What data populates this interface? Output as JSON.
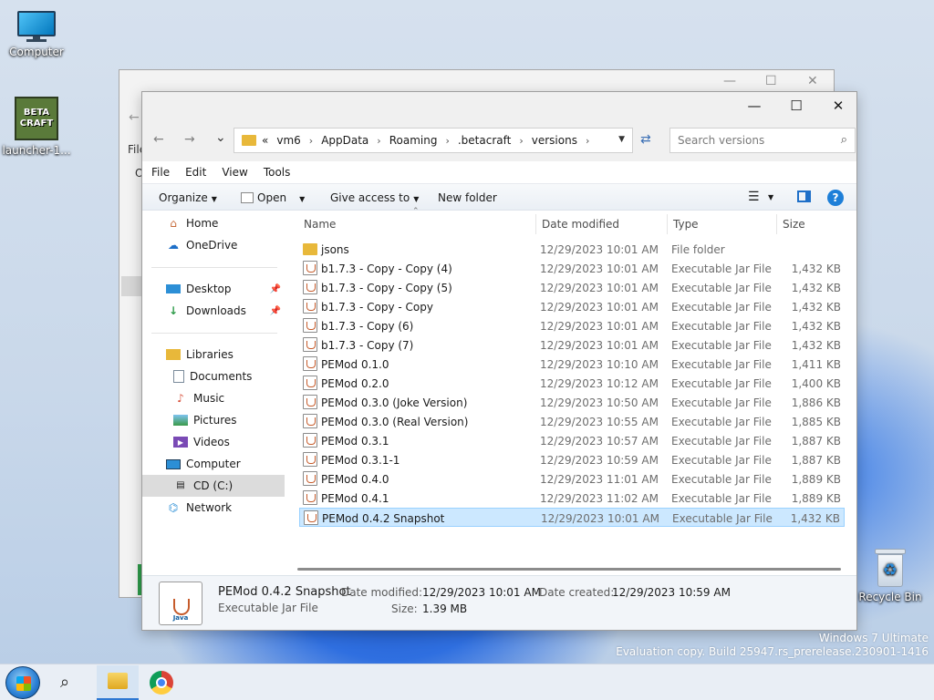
{
  "desktop": {
    "icons": [
      {
        "label": "Computer"
      },
      {
        "label": "launcher-1...",
        "logo_text": "BETA CRAFT"
      },
      {
        "label": "Recycle Bin"
      }
    ],
    "watermark": {
      "line1": "Windows 7 Ultimate",
      "line2": "Evaluation copy. Build 25947.rs_prerelease.230901-1416"
    }
  },
  "background_window": {
    "partial_text_1": "File",
    "partial_text_2": "O"
  },
  "window": {
    "controls": {
      "minimize": "—",
      "maximize": "☐",
      "close": "✕"
    },
    "nav": {
      "back": "←",
      "forward": "→",
      "recent": "⌄"
    },
    "address": {
      "overflow": "«",
      "crumbs": [
        "vm6",
        "AppData",
        "Roaming",
        ".betacraft",
        "versions"
      ],
      "separator": "›"
    },
    "search": {
      "placeholder": "Search versions"
    },
    "menu": [
      "File",
      "Edit",
      "View",
      "Tools"
    ],
    "toolbar": {
      "organize": "Organize",
      "open": "Open",
      "give_access": "Give access to",
      "new_folder": "New folder"
    },
    "nav_pane": {
      "home": "Home",
      "onedrive": "OneDrive",
      "desktop": "Desktop",
      "downloads": "Downloads",
      "libraries": "Libraries",
      "documents": "Documents",
      "music": "Music",
      "pictures": "Pictures",
      "videos": "Videos",
      "computer": "Computer",
      "cd": "CD (C:)",
      "network": "Network"
    },
    "columns": {
      "name": "Name",
      "date": "Date modified",
      "type": "Type",
      "size": "Size"
    },
    "files": [
      {
        "name": "jsons",
        "date": "12/29/2023 10:01 AM",
        "type": "File folder",
        "size": "",
        "kind": "folder"
      },
      {
        "name": "b1.7.3 - Copy - Copy (4)",
        "date": "12/29/2023 10:01 AM",
        "type": "Executable Jar File",
        "size": "1,432 KB",
        "kind": "jar"
      },
      {
        "name": "b1.7.3 - Copy - Copy (5)",
        "date": "12/29/2023 10:01 AM",
        "type": "Executable Jar File",
        "size": "1,432 KB",
        "kind": "jar"
      },
      {
        "name": "b1.7.3 - Copy - Copy",
        "date": "12/29/2023 10:01 AM",
        "type": "Executable Jar File",
        "size": "1,432 KB",
        "kind": "jar"
      },
      {
        "name": "b1.7.3 - Copy (6)",
        "date": "12/29/2023 10:01 AM",
        "type": "Executable Jar File",
        "size": "1,432 KB",
        "kind": "jar"
      },
      {
        "name": "b1.7.3 - Copy (7)",
        "date": "12/29/2023 10:01 AM",
        "type": "Executable Jar File",
        "size": "1,432 KB",
        "kind": "jar"
      },
      {
        "name": "PEMod 0.1.0",
        "date": "12/29/2023 10:10 AM",
        "type": "Executable Jar File",
        "size": "1,411 KB",
        "kind": "jar"
      },
      {
        "name": "PEMod 0.2.0",
        "date": "12/29/2023 10:12 AM",
        "type": "Executable Jar File",
        "size": "1,400 KB",
        "kind": "jar"
      },
      {
        "name": "PEMod 0.3.0 (Joke Version)",
        "date": "12/29/2023 10:50 AM",
        "type": "Executable Jar File",
        "size": "1,886 KB",
        "kind": "jar"
      },
      {
        "name": "PEMod 0.3.0 (Real Version)",
        "date": "12/29/2023 10:55 AM",
        "type": "Executable Jar File",
        "size": "1,885 KB",
        "kind": "jar"
      },
      {
        "name": "PEMod 0.3.1",
        "date": "12/29/2023 10:57 AM",
        "type": "Executable Jar File",
        "size": "1,887 KB",
        "kind": "jar"
      },
      {
        "name": "PEMod 0.3.1-1",
        "date": "12/29/2023 10:59 AM",
        "type": "Executable Jar File",
        "size": "1,887 KB",
        "kind": "jar"
      },
      {
        "name": "PEMod 0.4.0",
        "date": "12/29/2023 11:01 AM",
        "type": "Executable Jar File",
        "size": "1,889 KB",
        "kind": "jar"
      },
      {
        "name": "PEMod 0.4.1",
        "date": "12/29/2023 11:02 AM",
        "type": "Executable Jar File",
        "size": "1,889 KB",
        "kind": "jar"
      },
      {
        "name": "PEMod 0.4.2 Snapshot",
        "date": "12/29/2023 10:01 AM",
        "type": "Executable Jar File",
        "size": "1,432 KB",
        "kind": "jar",
        "selected": true
      }
    ],
    "details": {
      "name": "PEMod 0.4.2 Snapshot",
      "type": "Executable Jar File",
      "modified_label": "Date modified:",
      "modified": "12/29/2023 10:01 AM",
      "created_label": "Date created:",
      "created": "12/29/2023 10:59 AM",
      "size_label": "Size:",
      "size": "1.39 MB",
      "icon_text": "Java"
    }
  },
  "taskbar": {
    "search_icon": "⌕"
  }
}
